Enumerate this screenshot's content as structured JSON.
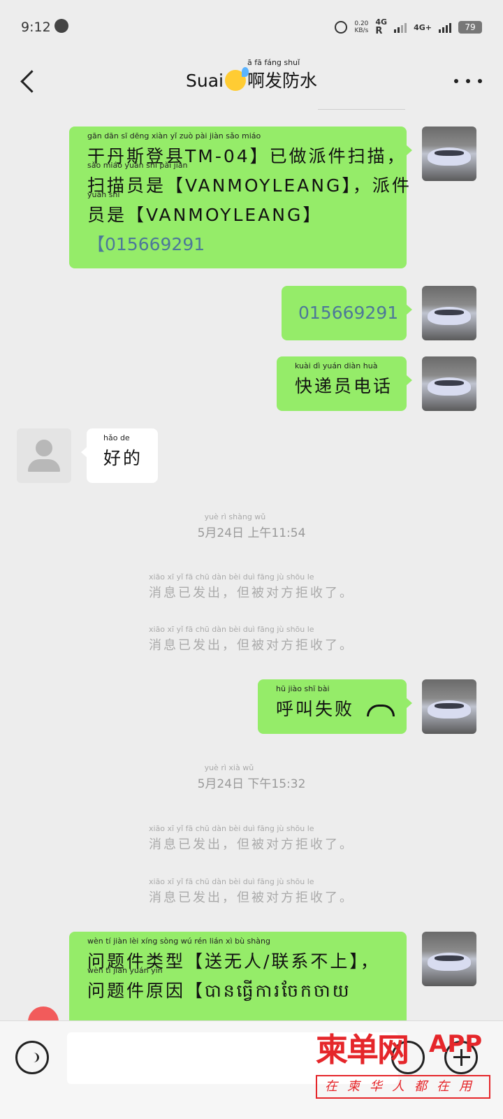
{
  "status_bar": {
    "time": "9:12",
    "speed_value": "0.20",
    "speed_unit": "KB/s",
    "roaming": "R",
    "net1": "4G",
    "net2": "4G+",
    "battery": "79"
  },
  "header": {
    "title_prefix": "Suai",
    "title_suffix": "啊发防水",
    "title_pinyin": "ā   fā  fáng shuǐ"
  },
  "messages": [
    {
      "side": "right",
      "lines": [
        {
          "text": "干丹斯登县TM-04】已做派件扫描，",
          "pinyin": "gān  dān  sī  dēng xiàn                       yǐ  zuò  pài  jiàn sǎo miáo"
        },
        {
          "text": "扫描员是【VANMOYLEANG】，派件",
          "pinyin": "sǎo miáo yuán shì                                                     pài  jiàn"
        },
        {
          "text": "员是【VANMOYLEANG】",
          "pinyin": "yuán shì"
        }
      ],
      "link": "【015669291"
    },
    {
      "side": "right",
      "link": "015669291"
    },
    {
      "side": "right",
      "text": "快递员电话",
      "pinyin": "kuài  dì  yuán diàn  huà"
    },
    {
      "side": "left",
      "text": "好的",
      "pinyin": "hǎo  de"
    }
  ],
  "timestamp1": {
    "text": "5月24日 上午11:54",
    "pinyin": "yuè      rì   shàng wǔ"
  },
  "system_msgs": {
    "text": "消息已发出，但被对方拒收了。",
    "pinyin": "xiāo  xī   yǐ   fā  chū         dàn  bèi  duì fāng  jù shōu  le"
  },
  "call": {
    "text": "呼叫失败",
    "pinyin": "hū  jiào shī  bài"
  },
  "timestamp2": {
    "text": "5月24日 下午15:32",
    "pinyin": "yuè      rì    xià  wǔ"
  },
  "last_message": {
    "lines": [
      {
        "text": "问题件类型【送无人/联系不上】，",
        "pinyin": "wèn  tí  jiàn  lèi  xíng    sòng  wú  rén       lián  xì   bù shàng"
      },
      {
        "text": "问题件原因【បានធ្វើការចែកចាយ",
        "pinyin": "wèn  tí   jiàn yuán yīn"
      }
    ]
  },
  "watermark": {
    "brand": "柬单网",
    "app": "APP",
    "slogan": "在柬华人都在用"
  }
}
